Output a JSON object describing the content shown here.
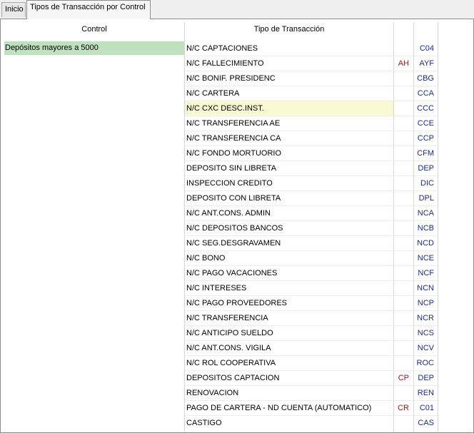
{
  "tabs": [
    {
      "label": "Inicio"
    },
    {
      "label": "Tipos de Transacción por Control"
    }
  ],
  "table": {
    "headers": {
      "control": "Control",
      "tipo": "Tipo de Transacción"
    },
    "control_value": "Depósitos mayores a 5000",
    "rows": [
      {
        "tipo": "N/C CAPTACIONES",
        "flag": "",
        "code": "C04"
      },
      {
        "tipo": "N/C FALLECIMIENTO",
        "flag": "AH",
        "code": "AYF"
      },
      {
        "tipo": "N/C BONIF. PRESIDENC",
        "flag": "",
        "code": "CBG"
      },
      {
        "tipo": "N/C CARTERA",
        "flag": "",
        "code": "CCA"
      },
      {
        "tipo": "N/C CXC DESC.INST.",
        "flag": "",
        "code": "CCC",
        "highlighted": true
      },
      {
        "tipo": "N/C TRANSFERENCIA AE",
        "flag": "",
        "code": "CCE"
      },
      {
        "tipo": "N/C TRANSFERENCIA CA",
        "flag": "",
        "code": "CCP"
      },
      {
        "tipo": "N/C FONDO MORTUORIO",
        "flag": "",
        "code": "CFM"
      },
      {
        "tipo": "DEPOSITO SIN LIBRETA",
        "flag": "",
        "code": "DEP"
      },
      {
        "tipo": "INSPECCION CREDITO",
        "flag": "",
        "code": "DIC"
      },
      {
        "tipo": "DEPOSITO CON LIBRETA",
        "flag": "",
        "code": "DPL"
      },
      {
        "tipo": "N/C ANT.CONS. ADMIN",
        "flag": "",
        "code": "NCA"
      },
      {
        "tipo": "N/C DEPOSITOS BANCOS",
        "flag": "",
        "code": "NCB"
      },
      {
        "tipo": "N/C SEG.DESGRAVAMEN",
        "flag": "",
        "code": "NCD"
      },
      {
        "tipo": "N/C BONO",
        "flag": "",
        "code": "NCE"
      },
      {
        "tipo": "N/C PAGO VACACIONES",
        "flag": "",
        "code": "NCF"
      },
      {
        "tipo": "N/C INTERESES",
        "flag": "",
        "code": "NCN"
      },
      {
        "tipo": "N/C PAGO PROVEEDORES",
        "flag": "",
        "code": "NCP"
      },
      {
        "tipo": "N/C TRANSFERENCIA",
        "flag": "",
        "code": "NCR"
      },
      {
        "tipo": "N/C ANTICIPO SUELDO",
        "flag": "",
        "code": "NCS"
      },
      {
        "tipo": "N/C ANT.CONS. VIGILA",
        "flag": "",
        "code": "NCV"
      },
      {
        "tipo": "N/C ROL COOPERATIVA",
        "flag": "",
        "code": "ROC"
      },
      {
        "tipo": "DEPOSITOS CAPTACION",
        "flag": "CP",
        "code": "DEP"
      },
      {
        "tipo": "RENOVACION",
        "flag": "",
        "code": "REN"
      },
      {
        "tipo": "PAGO DE CARTERA - ND CUENTA (AUTOMATICO)",
        "flag": "CR",
        "code": "C01"
      },
      {
        "tipo": "CASTIGO",
        "flag": "",
        "code": "CAS"
      }
    ]
  },
  "colors": {
    "control_highlight": "#bfe1bf",
    "row_highlight": "#fafad2",
    "flag_text": "#a0191e",
    "code_text": "#1a2c8c"
  }
}
